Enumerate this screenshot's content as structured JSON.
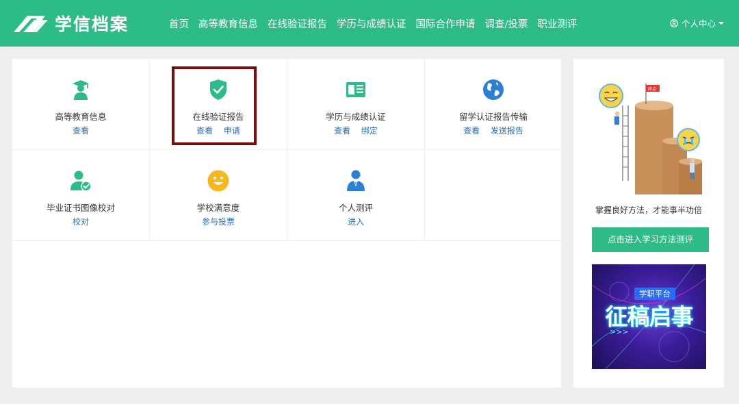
{
  "header": {
    "logo_text": "学信档案",
    "nav": [
      "首页",
      "高等教育信息",
      "在线验证报告",
      "学历与成绩认证",
      "国际合作申请",
      "调查/投票",
      "职业测评"
    ],
    "user_center": "个人中心",
    "bg_color": "#2dbb87"
  },
  "services": [
    {
      "label": "高等教育信息",
      "icon": "graduate-icon",
      "links": [
        "查看"
      ]
    },
    {
      "label": "在线验证报告",
      "icon": "shield-check-icon",
      "links": [
        "查看",
        "申请"
      ]
    },
    {
      "label": "学历与成绩认证",
      "icon": "document-icon",
      "links": [
        "查看",
        "绑定"
      ]
    },
    {
      "label": "留学认证报告传输",
      "icon": "globe-icon",
      "links": [
        "查看",
        "发送报告"
      ]
    },
    {
      "label": "毕业证书图像校对",
      "icon": "user-check-icon",
      "links": [
        "校对"
      ]
    },
    {
      "label": "学校满意度",
      "icon": "smiley-icon",
      "links": [
        "参与投票"
      ]
    },
    {
      "label": "个人测评",
      "icon": "person-suit-icon",
      "links": [
        "进入"
      ]
    }
  ],
  "sidebar": {
    "illustration_flag": "终点",
    "tagline": "掌握良好方法，才能事半功倍",
    "button_label": "点击进入学习方法测评",
    "banner_tag": "学职平台",
    "banner_title": "征稿启事",
    "banner_arrows": ">>>"
  },
  "highlight_color": "#7b0a0a",
  "link_color": "#2b6fbd"
}
